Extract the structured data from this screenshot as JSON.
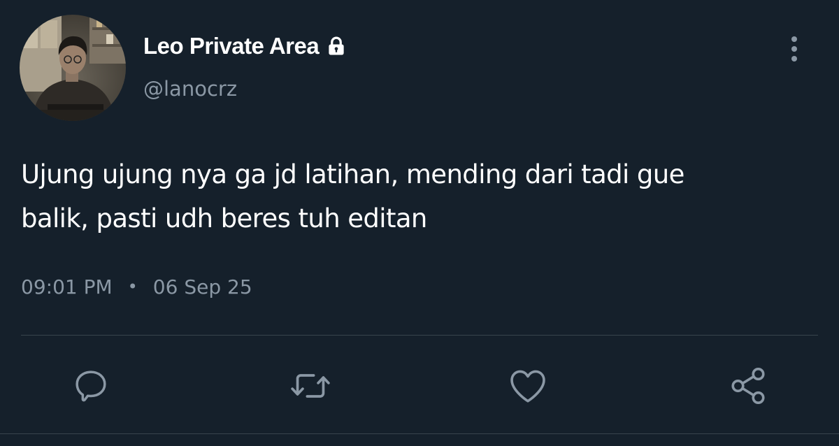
{
  "author": {
    "display_name": "Leo Private Area",
    "handle": "@lanocrz",
    "avatar_icon": "profile-photo",
    "protected_icon": "lock-icon"
  },
  "tweet": {
    "text_line_1": "Ujung ujung nya ga jd latihan, mending dari tadi gue",
    "text_line_2": "balik, pasti udh beres tuh editan",
    "time": "09:01 PM",
    "separator": "•",
    "date": "06 Sep 25"
  },
  "menu": {
    "more_icon": "vertical-ellipsis-icon"
  },
  "actions": [
    {
      "name": "reply",
      "icon": "speech-bubble-icon"
    },
    {
      "name": "retweet",
      "icon": "retweet-icon"
    },
    {
      "name": "like",
      "icon": "heart-icon"
    },
    {
      "name": "share",
      "icon": "share-nodes-icon"
    }
  ],
  "colors": {
    "background": "#15202b",
    "primary_text": "#ffffff",
    "secondary_text": "#8b98a5",
    "divider": "#38444d"
  }
}
